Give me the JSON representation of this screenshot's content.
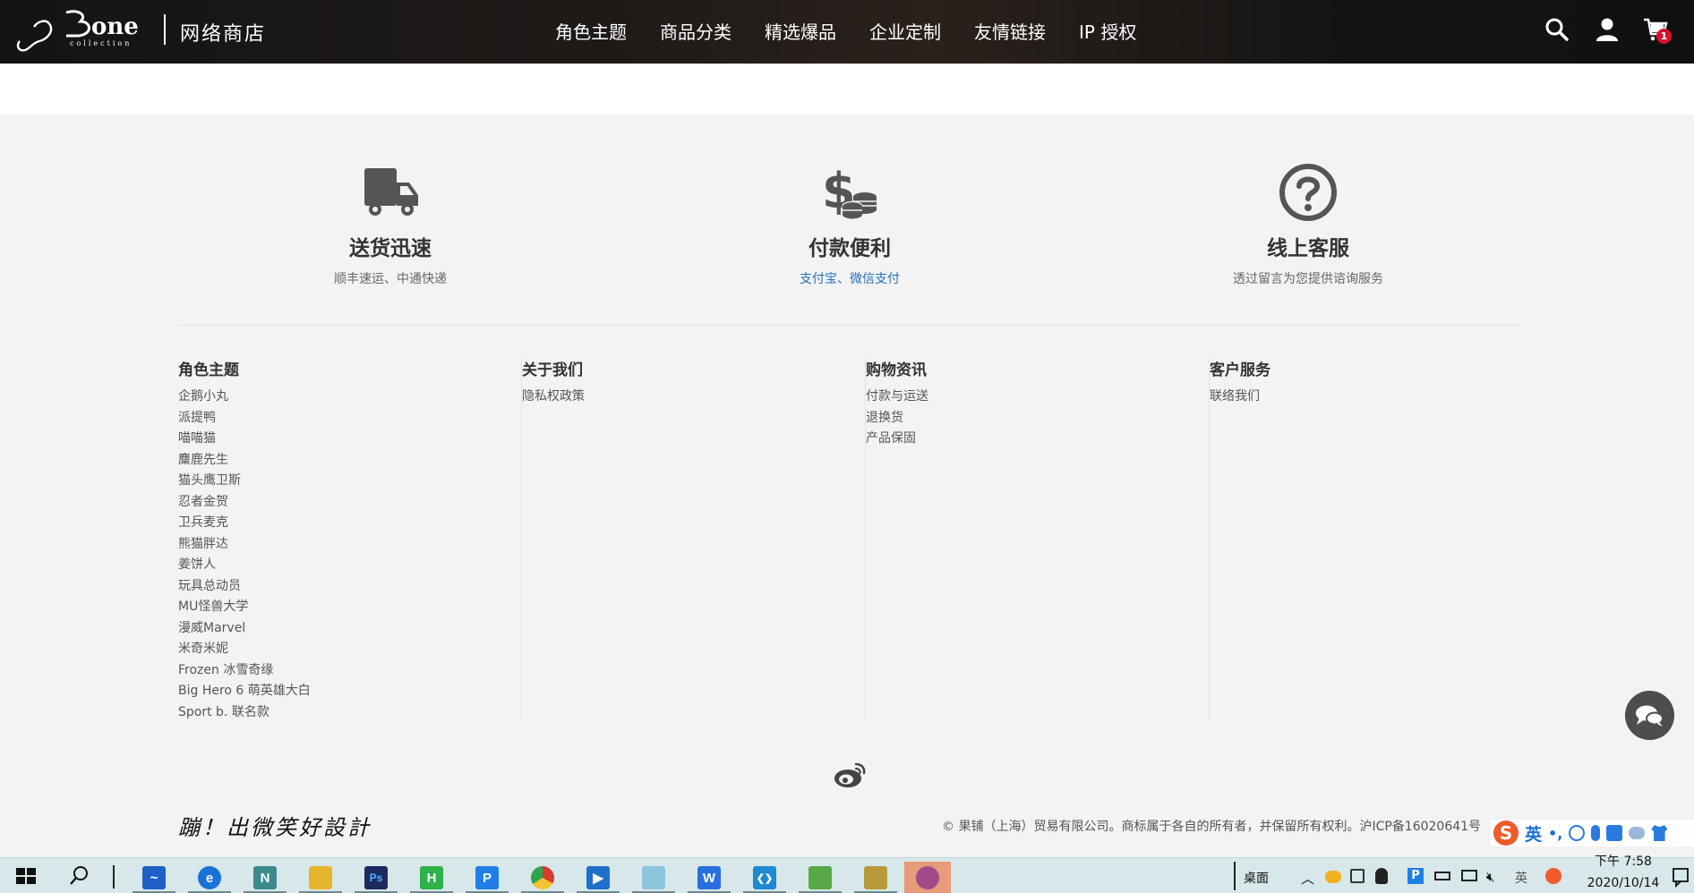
{
  "header": {
    "logo_text": "3one collection",
    "store_name": "网络商店",
    "nav": [
      "角色主题",
      "商品分类",
      "精选爆品",
      "企业定制",
      "友情链接",
      "IP 授权"
    ],
    "icons": [
      "search-icon",
      "user-icon",
      "cart-icon"
    ],
    "cart_count": "1"
  },
  "features": [
    {
      "icon": "truck-icon",
      "title": "送货迅速",
      "desc": "顺丰速运、中通快递"
    },
    {
      "icon": "dollar-coins-icon",
      "title": "付款便利",
      "desc": "支付宝、微信支付"
    },
    {
      "icon": "question-circle-icon",
      "title": "线上客服",
      "desc": "透过留言为您提供谘询服务"
    }
  ],
  "footer": {
    "columns": [
      {
        "title": "角色主题",
        "links": [
          "企鹅小丸",
          "派提鸭",
          "喵喵猫",
          "麋鹿先生",
          "猫头鹰卫斯",
          "忍者金贺",
          "卫兵麦克",
          "熊猫胖达",
          "姜饼人",
          "玩具总动员",
          "MU怪兽大学",
          "漫威Marvel",
          "米奇米妮",
          "Frozen 冰雪奇缘",
          "Big Hero 6 萌英雄大白",
          "Sport b. 联名款"
        ]
      },
      {
        "title": "关于我们",
        "links": [
          "隐私权政策"
        ]
      },
      {
        "title": "购物资讯",
        "links": [
          "付款与运送",
          "退换货",
          "产品保固"
        ]
      },
      {
        "title": "客户服务",
        "links": [
          "联络我们"
        ]
      }
    ],
    "slogan": "蹦！出微笑好設計",
    "copyright": "© 果铺（上海）贸易有限公司。商标属于各自的所有者，并保留所有权利。沪ICP备16020641号"
  },
  "ime": {
    "logo": "S",
    "mode": "英"
  },
  "taskbar": {
    "apps": [
      {
        "name": "whiteboard",
        "color": "#1e60c8",
        "label": "~"
      },
      {
        "name": "edge",
        "color": "#1a73d9",
        "label": "e"
      },
      {
        "name": "notepad-plus",
        "color": "#3c8a8e",
        "label": "N"
      },
      {
        "name": "file-explorer",
        "color": "#e8b430",
        "label": ""
      },
      {
        "name": "photoshop",
        "color": "#1b2b5e",
        "label": "Ps"
      },
      {
        "name": "hbuilder",
        "color": "#2db24a",
        "label": "H"
      },
      {
        "name": "pp-app",
        "color": "#1f7ee8",
        "label": "P"
      },
      {
        "name": "chrome",
        "color": "#d93a2e",
        "label": "◉"
      },
      {
        "name": "media-player",
        "color": "#1e6fc8",
        "label": "▶"
      },
      {
        "name": "notes",
        "color": "#8cc6dc",
        "label": ""
      },
      {
        "name": "wps",
        "color": "#2a6fe0",
        "label": "W"
      },
      {
        "name": "vscode",
        "color": "#1f8ad2",
        "label": "❮❯"
      },
      {
        "name": "image-viewer",
        "color": "#58a848",
        "label": ""
      },
      {
        "name": "folder-app",
        "color": "#b89a3a",
        "label": ""
      },
      {
        "name": "music-app",
        "color": "#a04a8a",
        "label": ""
      }
    ],
    "desktop_label": "桌面",
    "ime_tray": "英",
    "time": "下午 7:58",
    "date": "2020/10/14"
  },
  "colors": {
    "header_bg": "#1a1614",
    "footer_bg": "#f3f3f3",
    "link_blue": "#2a6fb8",
    "badge_red": "#d6102e"
  }
}
